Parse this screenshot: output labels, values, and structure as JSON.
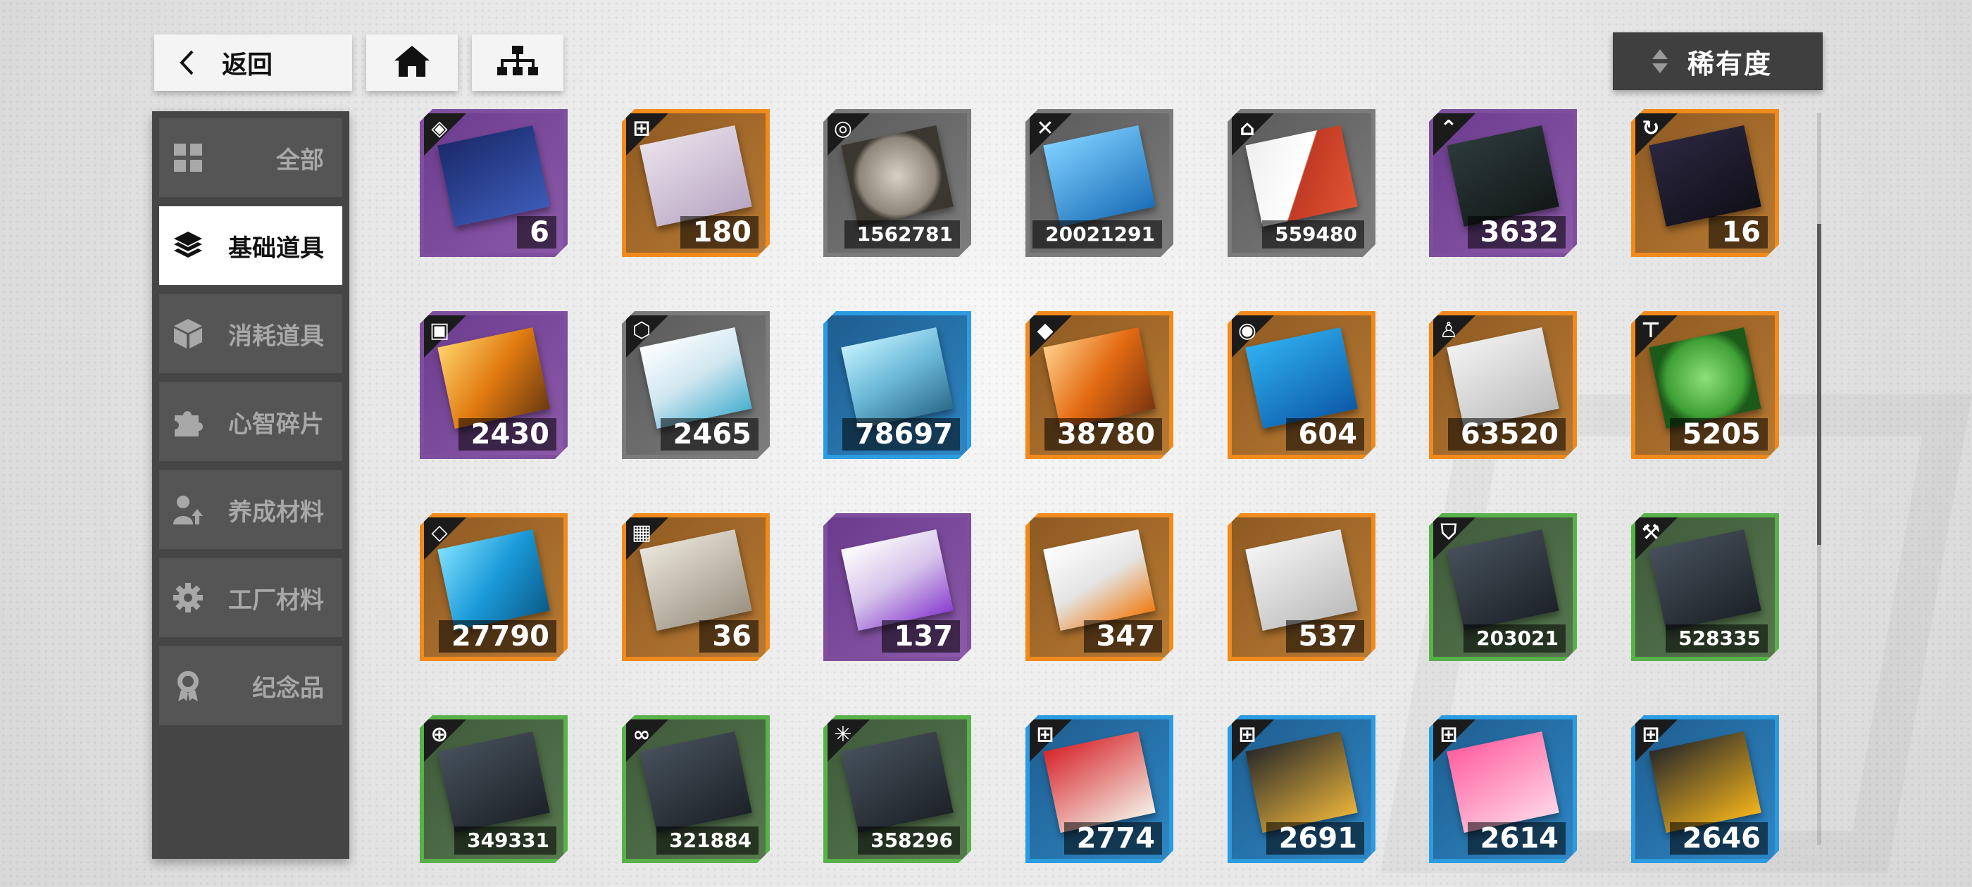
{
  "topbar": {
    "back_label": "返回",
    "sort_label": "稀有度"
  },
  "sidebar": {
    "items": [
      {
        "label": "全部",
        "icon": "grid-icon",
        "active": false
      },
      {
        "label": "基础道具",
        "icon": "layers-icon",
        "active": true
      },
      {
        "label": "消耗道具",
        "icon": "box-icon",
        "active": false
      },
      {
        "label": "心智碎片",
        "icon": "puzzle-icon",
        "active": false
      },
      {
        "label": "养成材料",
        "icon": "user-upgrade-icon",
        "active": false
      },
      {
        "label": "工厂材料",
        "icon": "gear-icon",
        "active": false
      },
      {
        "label": "纪念品",
        "icon": "medal-icon",
        "active": false
      }
    ]
  },
  "colors": {
    "purple": "#7e4f9d",
    "orange": "#f08a1c",
    "gray": "#7b7b7b",
    "blue": "#2c9be0",
    "green": "#58b14a"
  },
  "items": [
    {
      "count": "6",
      "rarity": "purple",
      "icon": "diamond-arrow-icon",
      "art": "basic-voucher"
    },
    {
      "count": "180",
      "rarity": "orange",
      "icon": "gift-icon",
      "art": "memoir-voucher"
    },
    {
      "count": "1562781",
      "rarity": "gray",
      "icon": "coin-icon",
      "art": "coin"
    },
    {
      "count": "20021291",
      "rarity": "gray",
      "icon": "xp-icon",
      "art": "xp-box"
    },
    {
      "count": "559480",
      "rarity": "gray",
      "icon": "exp-icon",
      "art": "exp-card"
    },
    {
      "count": "3632",
      "rarity": "purple",
      "icon": "chevron-up-icon",
      "art": "upgrade-pack"
    },
    {
      "count": "16",
      "rarity": "orange",
      "icon": "refresh-icon",
      "art": "refresh-pack"
    },
    {
      "count": "2430",
      "rarity": "purple",
      "icon": "square-icon",
      "art": "crystal"
    },
    {
      "count": "2465",
      "rarity": "gray",
      "icon": "cube-icon",
      "art": "oasis-box"
    },
    {
      "count": "78697",
      "rarity": "blue",
      "icon": "",
      "art": "glass-cube"
    },
    {
      "count": "38780",
      "rarity": "orange",
      "icon": "gem-icon",
      "art": "orange-gem"
    },
    {
      "count": "604",
      "rarity": "orange",
      "icon": "signal-icon",
      "art": "discrete-points"
    },
    {
      "count": "63520",
      "rarity": "orange",
      "icon": "people-icon",
      "art": "people-card"
    },
    {
      "count": "5205",
      "rarity": "orange",
      "icon": "roller-icon",
      "art": "paint-token"
    },
    {
      "count": "27790",
      "rarity": "orange",
      "icon": "diamond-icon",
      "art": "blue-frame"
    },
    {
      "count": "36",
      "rarity": "orange",
      "icon": "chip-icon",
      "art": "chip-card"
    },
    {
      "count": "137",
      "rarity": "purple",
      "icon": "",
      "art": "eff-card-purple"
    },
    {
      "count": "347",
      "rarity": "orange",
      "icon": "",
      "art": "eff-card-orange"
    },
    {
      "count": "537",
      "rarity": "orange",
      "icon": "",
      "art": "refresh-card"
    },
    {
      "count": "203021",
      "rarity": "green",
      "icon": "shield-icon",
      "art": "mission-data"
    },
    {
      "count": "528335",
      "rarity": "green",
      "icon": "hammer-icon",
      "art": "mission-data"
    },
    {
      "count": "349331",
      "rarity": "green",
      "icon": "target-icon",
      "art": "mission-data"
    },
    {
      "count": "321884",
      "rarity": "green",
      "icon": "link-icon",
      "art": "mission-data"
    },
    {
      "count": "358296",
      "rarity": "green",
      "icon": "spark-icon",
      "art": "mission-data"
    },
    {
      "count": "2774",
      "rarity": "blue",
      "icon": "gift-icon",
      "art": "food-red"
    },
    {
      "count": "2691",
      "rarity": "blue",
      "icon": "gift-icon",
      "art": "food-fries"
    },
    {
      "count": "2614",
      "rarity": "blue",
      "icon": "gift-icon",
      "art": "food-cake"
    },
    {
      "count": "2646",
      "rarity": "blue",
      "icon": "gift-icon",
      "art": "food-honey"
    }
  ]
}
